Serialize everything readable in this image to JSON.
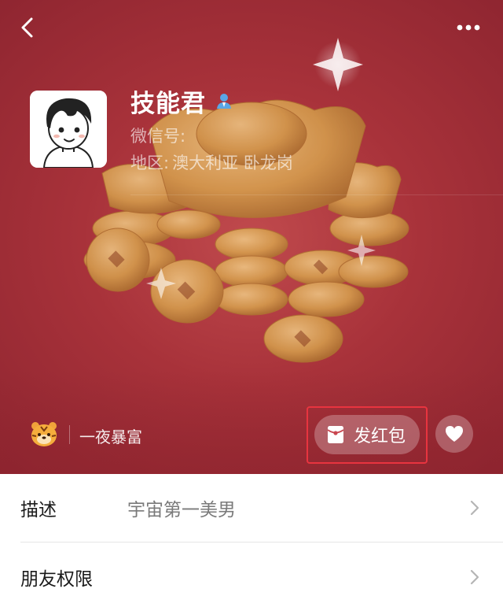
{
  "header": {
    "back_icon": "chevron-left-icon",
    "more_icon": "more-dots-icon"
  },
  "profile": {
    "name": "技能君",
    "badge_icon": "user-badge-icon",
    "wechat_id_label": "微信号:",
    "region_label": "地区:",
    "region_value": "澳大利亚 卧龙岗"
  },
  "status": {
    "icon": "tiger-icon",
    "text": "一夜暴富"
  },
  "actions": {
    "hongbao_label": "发红包",
    "hongbao_icon": "red-envelope-icon",
    "like_icon": "heart-icon",
    "highlight_color": "#e8343f"
  },
  "info_rows": [
    {
      "label": "描述",
      "value": "宇宙第一美男"
    },
    {
      "label": "朋友权限",
      "value": ""
    }
  ],
  "colors": {
    "hero_background": "#a8323a",
    "gold": "#d9a84e"
  }
}
